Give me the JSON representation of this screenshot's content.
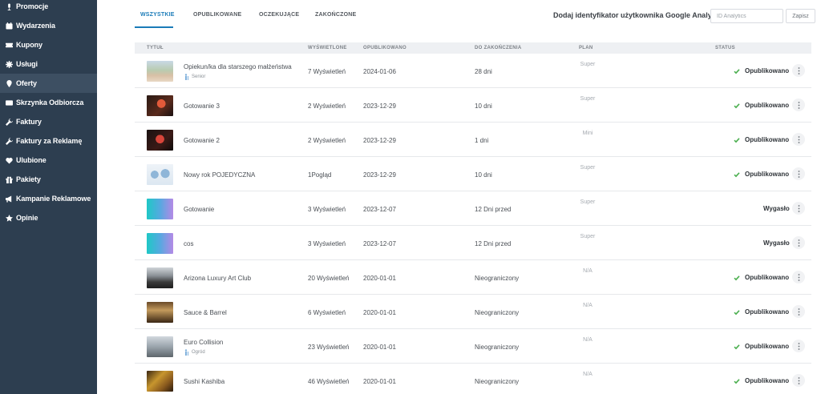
{
  "sidebar": {
    "items": [
      {
        "label": "Promocje",
        "icon": "microphone-icon"
      },
      {
        "label": "Wydarzenia",
        "icon": "calendar-icon"
      },
      {
        "label": "Kupony",
        "icon": "ticket-icon"
      },
      {
        "label": "Usługi",
        "icon": "cog-icon"
      },
      {
        "label": "Oferty",
        "icon": "map-pin-icon",
        "active": true
      },
      {
        "label": "Skrzynka Odbiorcza",
        "icon": "envelope-icon"
      },
      {
        "label": "Faktury",
        "icon": "wrench-icon"
      },
      {
        "label": "Faktury za Reklamę",
        "icon": "wrench-icon"
      },
      {
        "label": "Ulubione",
        "icon": "heart-icon"
      },
      {
        "label": "Pakiety",
        "icon": "gift-icon"
      },
      {
        "label": "Kampanie Reklamowe",
        "icon": "bullhorn-icon"
      },
      {
        "label": "Opinie",
        "icon": "star-icon"
      }
    ]
  },
  "tabs": [
    {
      "label": "WSZYSTKIE",
      "active": true
    },
    {
      "label": "OPUBLIKOWANE"
    },
    {
      "label": "OCZEKUJĄCE"
    },
    {
      "label": "ZAKOŃCZONE"
    }
  ],
  "analytics": {
    "label": "Dodaj identyfikator użytkownika Google Analytics",
    "placeholder": "ID Analytics",
    "save_label": "Zapisz"
  },
  "table": {
    "headers": {
      "title": "TYTUŁ",
      "views": "WYŚWIETLONE",
      "published": "OPUBLIKOWANO",
      "until_end": "DO ZAKOŃCZENIA",
      "plan": "PLAN",
      "status": "STATUS"
    },
    "rows": [
      {
        "title": "Opiekun/ka dla starszego małżeństwa",
        "tag": "Senior",
        "views": "7 Wyświetleń",
        "published": "2024-01-06",
        "until_end": "28 dni",
        "plan": "Super",
        "status": "Opublikowano",
        "thumb": "people"
      },
      {
        "title": "Gotowanie 3",
        "tag": "",
        "views": "2 Wyświetleń",
        "published": "2023-12-29",
        "until_end": "10 dni",
        "plan": "Super",
        "status": "Opublikowano",
        "thumb": "chef"
      },
      {
        "title": "Gotowanie 2",
        "tag": "",
        "views": "2 Wyświetleń",
        "published": "2023-12-29",
        "until_end": "1 dni",
        "plan": "Mini",
        "status": "Opublikowano",
        "thumb": "chef2"
      },
      {
        "title": "Nowy rok POJEDYCZNA",
        "tag": "",
        "views": "1Pogląd",
        "published": "2023-12-29",
        "until_end": "10 dni",
        "plan": "Super",
        "status": "Opublikowano",
        "thumb": "map"
      },
      {
        "title": "Gotowanie",
        "tag": "",
        "views": "3 Wyświetleń",
        "published": "2023-12-07",
        "until_end": "12 Dni przed",
        "plan": "Super",
        "status": "Wygasło",
        "thumb": "gradient"
      },
      {
        "title": "cos",
        "tag": "",
        "views": "3 Wyświetleń",
        "published": "2023-12-07",
        "until_end": "12 Dni przed",
        "plan": "Super",
        "status": "Wygasło",
        "thumb": "gradient"
      },
      {
        "title": "Arizona Luxury Art Club",
        "tag": "",
        "views": "20 Wyświetleń",
        "published": "2020-01-01",
        "until_end": "Nieograniczony",
        "plan": "N/A",
        "status": "Opublikowano",
        "thumb": "club"
      },
      {
        "title": "Sauce & Barrel",
        "tag": "",
        "views": "6 Wyświetleń",
        "published": "2020-01-01",
        "until_end": "Nieograniczony",
        "plan": "N/A",
        "status": "Opublikowano",
        "thumb": "bar"
      },
      {
        "title": "Euro Collision",
        "tag": "Ogród",
        "views": "23 Wyświetleń",
        "published": "2020-01-01",
        "until_end": "Nieograniczony",
        "plan": "N/A",
        "status": "Opublikowano",
        "thumb": "garage"
      },
      {
        "title": "Sushi Kashiba",
        "tag": "",
        "views": "46 Wyświetleń",
        "published": "2020-01-01",
        "until_end": "Nieograniczony",
        "plan": "N/A",
        "status": "Opublikowano",
        "thumb": "sushi"
      }
    ]
  },
  "colors": {
    "sidebar_bg": "#2d3e50",
    "sidebar_active": "#3d4f62",
    "accent": "#1a7bb8",
    "check": "#4caf50"
  }
}
